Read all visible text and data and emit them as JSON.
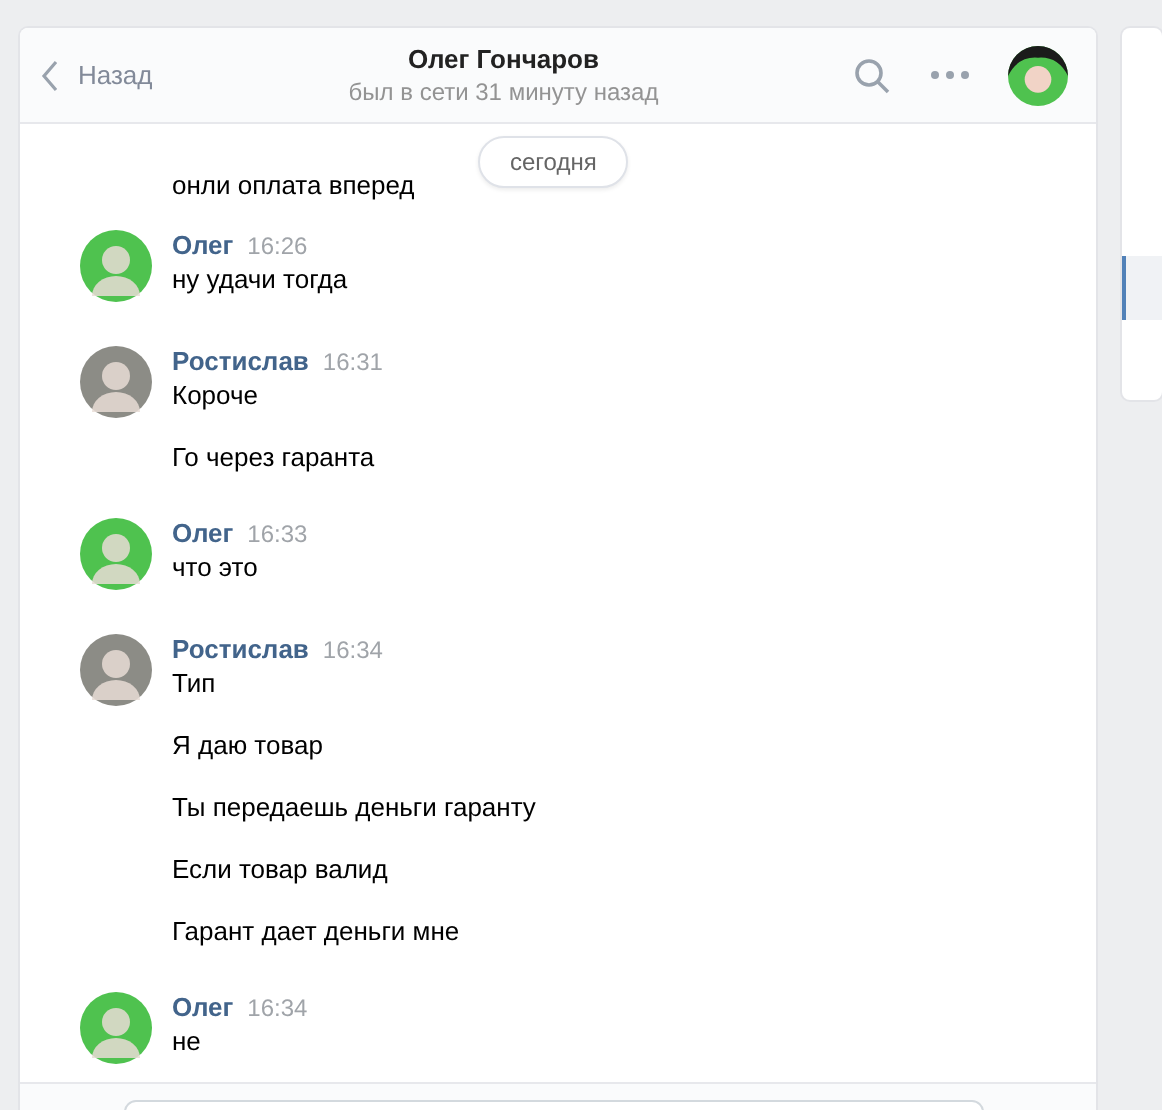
{
  "header": {
    "back_label": "Назад",
    "title": "Олег Гончаров",
    "status": "был в сети 31 минуту назад"
  },
  "date_badge": "сегодня",
  "orphan_messages": [
    "онли оплата вперед"
  ],
  "groups": [
    {
      "author": "Олег",
      "time": "16:26",
      "color": "#4fc24f",
      "messages": [
        "ну удачи тогда"
      ]
    },
    {
      "author": "Ростислав",
      "time": "16:31",
      "color": "#8c8c86",
      "messages": [
        "Короче",
        "Го через гаранта"
      ]
    },
    {
      "author": "Олег",
      "time": "16:33",
      "color": "#4fc24f",
      "messages": [
        "что это"
      ]
    },
    {
      "author": "Ростислав",
      "time": "16:34",
      "color": "#8c8c86",
      "messages": [
        "Тип",
        "Я даю товар",
        "Ты передаешь деньги гаранту",
        "Если товар валид",
        "Гарант дает деньги мне"
      ]
    },
    {
      "author": "Олег",
      "time": "16:34",
      "color": "#4fc24f",
      "messages": [
        "не"
      ]
    }
  ]
}
